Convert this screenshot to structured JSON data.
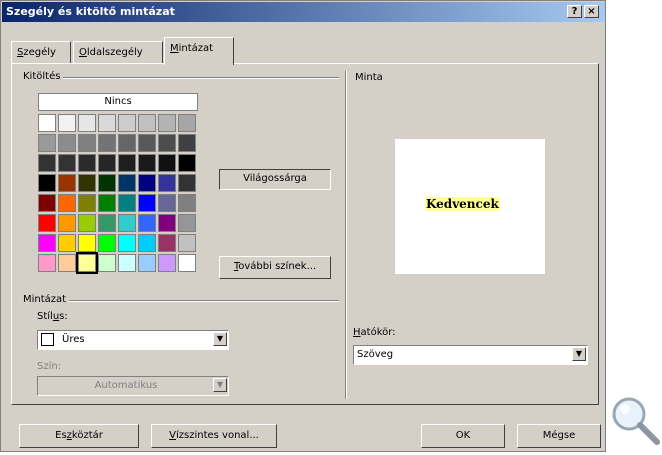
{
  "window": {
    "title": "Szegély és kitöltő mintázat",
    "help_label": "?",
    "close_label": "×"
  },
  "tabs": [
    {
      "label": "Szegély",
      "underline": "S",
      "rest": "zegély"
    },
    {
      "label": "Oldalszegély",
      "underline": "O",
      "rest": "ldalszegély"
    },
    {
      "label": "Mintázat",
      "underline": "M",
      "rest": "intázat",
      "active": true
    }
  ],
  "fill": {
    "group_label": "Kitöltés",
    "none_label": "Nincs",
    "selected_color_name": "Világossárga",
    "more_colors_pre": "",
    "more_colors_u": "T",
    "more_colors_rest": "ovábbi színek...",
    "selected_index": 58,
    "palette": [
      "#ffffff",
      "#f2f2f2",
      "#e6e6e6",
      "#d9d9d9",
      "#cccccc",
      "#c0c0c0",
      "#b3b3b3",
      "#a6a6a6",
      "#999999",
      "#8c8c8c",
      "#808080",
      "#737373",
      "#666666",
      "#595959",
      "#4d4d4d",
      "#404040",
      "#333333",
      "#333333",
      "#2b2b2b",
      "#262626",
      "#1f1f1f",
      "#1a1a1a",
      "#111111",
      "#000000",
      "#000000",
      "#993300",
      "#333300",
      "#003300",
      "#003366",
      "#000080",
      "#333399",
      "#333333",
      "#800000",
      "#ff6600",
      "#808000",
      "#008000",
      "#008080",
      "#0000ff",
      "#666699",
      "#808080",
      "#ff0000",
      "#ff9900",
      "#99cc00",
      "#339966",
      "#33cccc",
      "#3366ff",
      "#800080",
      "#969696",
      "#ff00ff",
      "#ffcc00",
      "#ffff00",
      "#00ff00",
      "#00ffff",
      "#00ccff",
      "#993366",
      "#c0c0c0",
      "#ff99cc",
      "#ffcc99",
      "#ffff99",
      "#ccffcc",
      "#ccffff",
      "#99ccff",
      "#cc99ff",
      "#ffffff"
    ]
  },
  "pattern": {
    "group_label": "Mintázat",
    "style_label_pre": "Stíl",
    "style_label_u": "u",
    "style_label_rest": "s:",
    "style_value": "Üres",
    "color_label": "Szín:",
    "color_value": "Automatikus"
  },
  "preview": {
    "group_label": "Minta",
    "sample_text": "Kedvencek"
  },
  "apply_to": {
    "label_u": "H",
    "label_rest": "atókör:",
    "value": "Szöveg"
  },
  "footer": {
    "toolbar_pre": "Es",
    "toolbar_u": "z",
    "toolbar_rest": "köztár",
    "hline_u": "V",
    "hline_rest": "ízszintes vonal...",
    "ok_label": "OK",
    "cancel_label": "Mégse"
  },
  "icons": {
    "zoom": "magnifier-icon",
    "dropdown": "chevron-down-icon"
  }
}
